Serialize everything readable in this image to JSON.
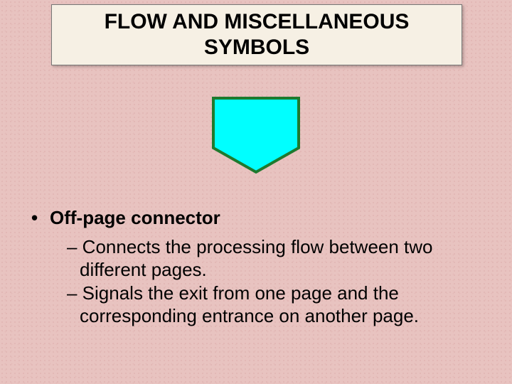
{
  "title": "FLOW AND MISCELLANEOUS SYMBOLS",
  "symbol": {
    "name": "off-page-connector",
    "fill": "#00ffff",
    "stroke": "#1e7a2e",
    "strokeWidth": 4
  },
  "bullets": {
    "main": "Off-page connector",
    "sub1": "– Connects the processing flow between two different pages.",
    "sub2": "– Signals the exit from one page and the corresponding entrance on another page."
  }
}
